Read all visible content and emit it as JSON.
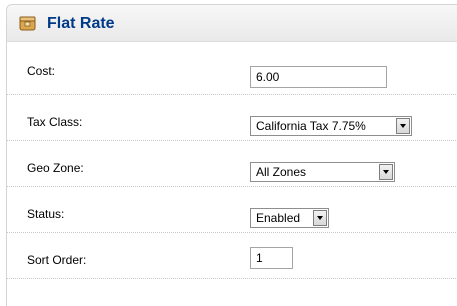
{
  "panel": {
    "title": "Flat Rate",
    "icon": "box-icon"
  },
  "form": {
    "cost": {
      "label": "Cost:",
      "value": "6.00"
    },
    "tax_class": {
      "label": "Tax Class:",
      "value": "California Tax 7.75%"
    },
    "geo_zone": {
      "label": "Geo Zone:",
      "value": "All Zones"
    },
    "status": {
      "label": "Status:",
      "value": "Enabled"
    },
    "sort_order": {
      "label": "Sort Order:",
      "value": "1"
    }
  },
  "colors": {
    "title": "#003a88",
    "heading_bg": "#efefef",
    "border": "#d4d4d4"
  }
}
